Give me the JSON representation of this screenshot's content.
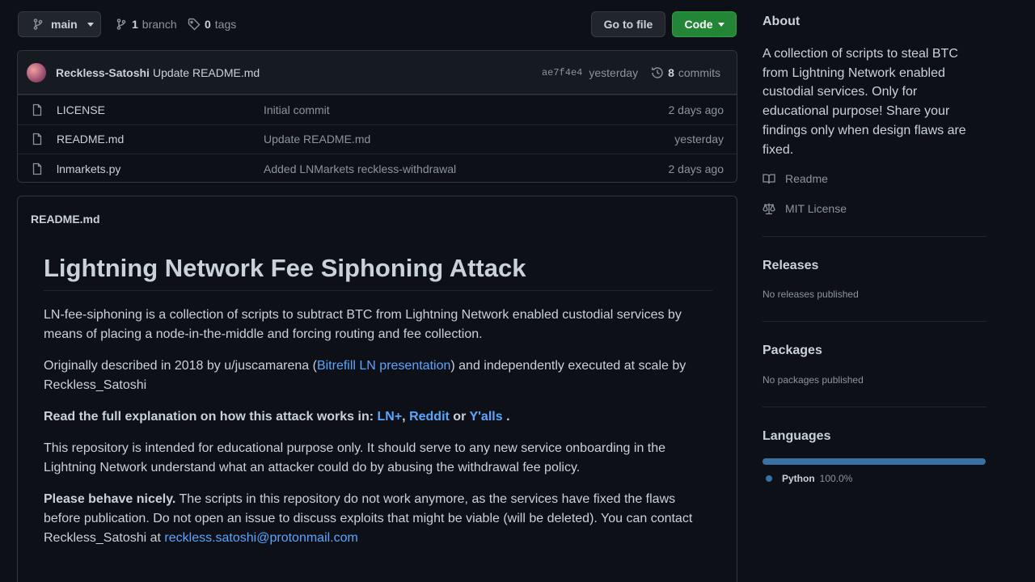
{
  "top_bar": {
    "branch": "main",
    "branch_count": "1",
    "branch_label": "branch",
    "tag_count": "0",
    "tag_label": "tags",
    "goto_file": "Go to file",
    "code": "Code"
  },
  "commit": {
    "author": "Reckless-Satoshi",
    "message": "Update README.md",
    "sha": "ae7f4e4",
    "time": "yesterday",
    "commit_count": "8",
    "commit_label": "commits"
  },
  "files": [
    {
      "name": "LICENSE",
      "message": "Initial commit",
      "time": "2 days ago"
    },
    {
      "name": "README.md",
      "message": "Update README.md",
      "time": "yesterday"
    },
    {
      "name": "lnmarkets.py",
      "message": "Added LNMarkets reckless-withdrawal",
      "time": "2 days ago"
    }
  ],
  "readme": {
    "header": "README.md",
    "title": "Lightning Network Fee Siphoning Attack",
    "p1": "LN-fee-siphoning is a collection of scripts to subtract BTC from Lightning Network enabled custodial services by means of placing a node-in-the-middle and forcing routing and fee collection.",
    "p2_before": "Originally described in 2018 by u/juscamarena (",
    "p2_link": "Bitrefill LN presentation",
    "p2_after": ") and independently executed at scale by Reckless_Satoshi",
    "p3_lead": "Read the full explanation on how this attack works in: ",
    "p3_link1": "LN+",
    "p3_sep1": ", ",
    "p3_link2": "Reddit",
    "p3_or": " or ",
    "p3_link3": "Y'alls",
    "p3_end": " .",
    "p4": "This repository is intended for educational purpose only. It should serve to any new service onboarding in the Lightning Network understand what an attacker could do by abusing the withdrawal fee policy.",
    "p5_bold": "Please behave nicely.",
    "p5_text": " The scripts in this repository do not work anymore, as the services have fixed the flaws before publication. Do not open an issue to discuss exploits that might be viable (will be deleted). You can contact Reckless_Satoshi at ",
    "p5_email": "reckless.satoshi@protonmail.com"
  },
  "sidebar": {
    "about_title": "About",
    "about_desc": "A collection of scripts to steal BTC from Lightning Network enabled custodial services. Only for educational purpose! Share your findings only when design flaws are fixed.",
    "readme_link": "Readme",
    "license_link": "MIT License",
    "releases_title": "Releases",
    "releases_empty": "No releases published",
    "packages_title": "Packages",
    "packages_empty": "No packages published",
    "languages_title": "Languages",
    "language": {
      "name": "Python",
      "percent": "100.0%",
      "share": 1.0,
      "color": "#3572A5"
    }
  }
}
